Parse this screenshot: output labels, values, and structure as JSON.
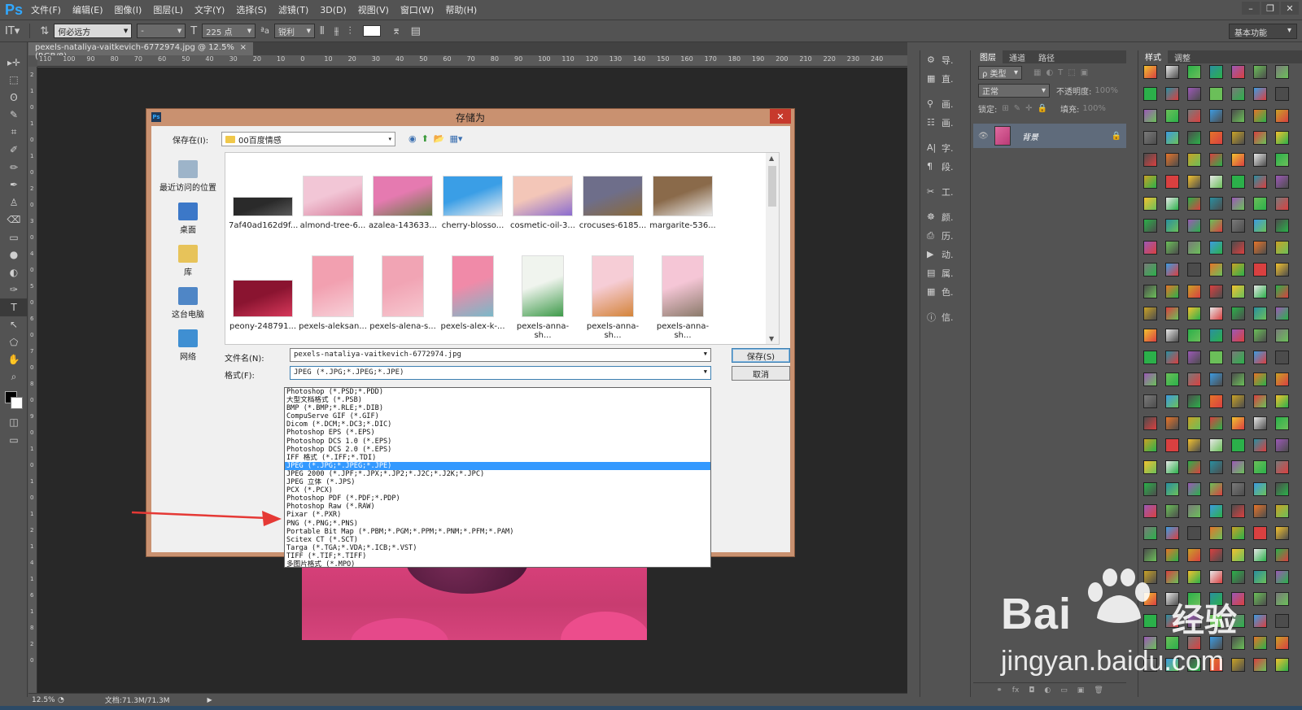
{
  "app": {
    "logo": "Ps"
  },
  "menu": [
    "文件(F)",
    "编辑(E)",
    "图像(I)",
    "图层(L)",
    "文字(Y)",
    "选择(S)",
    "滤镜(T)",
    "3D(D)",
    "视图(V)",
    "窗口(W)",
    "帮助(H)"
  ],
  "window_controls": {
    "minimize": "–",
    "restore": "❐",
    "close": "✕"
  },
  "options": {
    "font_family": "何必远方",
    "font_style": "-",
    "font_size": "225 点",
    "aa_label": "ªa",
    "antialias": "锐利",
    "workspace": "基本功能"
  },
  "document": {
    "tab_title": "pexels-nataliya-vaitkevich-6772974.jpg @ 12.5%(RGB/8)",
    "tab_close": "×",
    "ruler_h": [
      "110",
      "100",
      "90",
      "80",
      "70",
      "60",
      "50",
      "40",
      "30",
      "20",
      "10",
      "0",
      "10",
      "20",
      "30",
      "40",
      "50",
      "60",
      "70",
      "80",
      "90",
      "100",
      "110",
      "120",
      "130",
      "140",
      "150",
      "160",
      "170",
      "180",
      "190",
      "200",
      "210",
      "220",
      "230",
      "240"
    ],
    "ruler_v": [
      "2",
      "1",
      "0",
      "1",
      "0",
      "1",
      "0",
      "2",
      "0",
      "3",
      "0",
      "4",
      "0",
      "5",
      "0",
      "6",
      "0",
      "7",
      "0",
      "8",
      "0",
      "9",
      "0",
      "1",
      "0",
      "1",
      "0",
      "1",
      "2",
      "1",
      "4",
      "1",
      "6",
      "1",
      "8",
      "2",
      "0"
    ],
    "zoom": "12.5%",
    "doc_info": "文档:71.3M/71.3M",
    "status_arrow": "▶"
  },
  "tools": [
    "▸✛",
    "⬚",
    "ʘ",
    "✎",
    "⌗",
    "✐",
    "✏",
    "✒",
    "♙",
    "⌫",
    "▭",
    "●",
    "◐",
    "✑",
    "T",
    "↖",
    "⬠",
    "✋",
    "⌕"
  ],
  "mini_panel": [
    {
      "icon": "⚙",
      "label": "导."
    },
    {
      "icon": "▦",
      "label": "直."
    },
    {
      "icon": "⚲",
      "label": "画."
    },
    {
      "icon": "☷",
      "label": "画."
    },
    {
      "icon": "A|",
      "label": "字."
    },
    {
      "icon": "¶",
      "label": "段."
    },
    {
      "icon": "✂",
      "label": "工."
    },
    {
      "icon": "☸",
      "label": "颜."
    },
    {
      "icon": "⎙",
      "label": "历."
    },
    {
      "icon": "▶",
      "label": "动."
    },
    {
      "icon": "▤",
      "label": "属."
    },
    {
      "icon": "▦",
      "label": "色."
    },
    {
      "icon": "ⓘ",
      "label": "信."
    }
  ],
  "layers_panel": {
    "tabs": [
      "图层",
      "通道",
      "路径"
    ],
    "filter_kind": "ρ 类型",
    "blend_mode": "正常",
    "opacity_label": "不透明度:",
    "opacity_value": "100%",
    "lock_label": "锁定:",
    "fill_label": "填充:",
    "fill_value": "100%",
    "layer_name": "背景",
    "footer_icons": [
      "⚭",
      "fx",
      "◘",
      "◐",
      "▭",
      "▣",
      "🗑"
    ]
  },
  "styles_panel": {
    "tabs": [
      "样式",
      "调整"
    ]
  },
  "dialog": {
    "title": "存储为",
    "ps_badge": "Ps",
    "close": "✕",
    "save_in_label": "保存在(I):",
    "save_in_value": "00百度情感",
    "save_in_arrow": "▾",
    "nav_icons": [
      "◉",
      "⬆",
      "📂",
      "▦▾"
    ],
    "places": [
      {
        "label": "最近访问的位置",
        "color": "#9db4c9"
      },
      {
        "label": "桌面",
        "color": "#3c78c8"
      },
      {
        "label": "库",
        "color": "#e7c35a"
      },
      {
        "label": "这台电脑",
        "color": "#4f86c6"
      },
      {
        "label": "网络",
        "color": "#3f8fd2"
      }
    ],
    "files": [
      {
        "name": "7af40ad162d9f...",
        "c1": "#2a2a2a",
        "c2": "#5a5a5a"
      },
      {
        "name": "almond-tree-6...",
        "c1": "#f2c6d6",
        "c2": "#d77e9c"
      },
      {
        "name": "azalea-143633...",
        "c1": "#e57ab0",
        "c2": "#6a7a48"
      },
      {
        "name": "cherry-blosso...",
        "c1": "#3a9ee6",
        "c2": "#f0f0f0"
      },
      {
        "name": "cosmetic-oil-3...",
        "c1": "#f3c6b8",
        "c2": "#8a6ccf"
      },
      {
        "name": "crocuses-6185...",
        "c1": "#6e6e8a",
        "c2": "#8a6a3a"
      },
      {
        "name": "margarite-536...",
        "c1": "#8a6a4a",
        "c2": "#ececec"
      },
      {
        "name": "peony-248791...",
        "c1": "#8a1430",
        "c2": "#d6385a"
      },
      {
        "name": "pexels-aleksan...",
        "c1": "#f2a0b0",
        "c2": "#f7d0d8"
      },
      {
        "name": "pexels-alena-s...",
        "c1": "#f1a4b4",
        "c2": "#f7c8d0"
      },
      {
        "name": "pexels-alex-k-...",
        "c1": "#f08aa8",
        "c2": "#7ab8c8"
      },
      {
        "name": "pexels-anna-sh...",
        "c1": "#f0f4ee",
        "c2": "#3e9a4a"
      },
      {
        "name": "pexels-anna-sh...",
        "c1": "#f6cdd6",
        "c2": "#d4843a"
      },
      {
        "name": "pexels-anna-sh...",
        "c1": "#f5c6d6",
        "c2": "#8a7a6a"
      }
    ],
    "filename_label": "文件名(N):",
    "filename_value": "pexels-nataliya-vaitkevich-6772974.jpg",
    "format_label": "格式(F):",
    "format_value": "JPEG (*.JPG;*.JPEG;*.JPE)",
    "save_button": "保存(S)",
    "cancel_button": "取消",
    "format_options": [
      "Photoshop (*.PSD;*.PDD)",
      "大型文档格式 (*.PSB)",
      "BMP (*.BMP;*.RLE;*.DIB)",
      "CompuServe GIF (*.GIF)",
      "Dicom (*.DCM;*.DC3;*.DIC)",
      "Photoshop EPS (*.EPS)",
      "Photoshop DCS 1.0 (*.EPS)",
      "Photoshop DCS 2.0 (*.EPS)",
      "IFF 格式 (*.IFF;*.TDI)",
      "JPEG (*.JPG;*.JPEG;*.JPE)",
      "JPEG 2000 (*.JPF;*.JPX;*.JP2;*.J2C;*.J2K;*.JPC)",
      "JPEG 立体 (*.JPS)",
      "PCX (*.PCX)",
      "Photoshop PDF (*.PDF;*.PDP)",
      "Photoshop Raw (*.RAW)",
      "Pixar (*.PXR)",
      "PNG (*.PNG;*.PNS)",
      "Portable Bit Map (*.PBM;*.PGM;*.PPM;*.PNM;*.PFM;*.PAM)",
      "Scitex CT (*.SCT)",
      "Targa (*.TGA;*.VDA;*.ICB;*.VST)",
      "TIFF (*.TIF;*.TIFF)",
      "多图片格式 (*.MPO)"
    ],
    "selected_format_index": 9
  },
  "watermark": {
    "bai": "Bai",
    "cn": "经验",
    "url": "jingyan.baidu.com"
  },
  "colors": {
    "accent": "#3399ff",
    "dialog_frame": "#c99170",
    "arrow": "#e53935"
  }
}
